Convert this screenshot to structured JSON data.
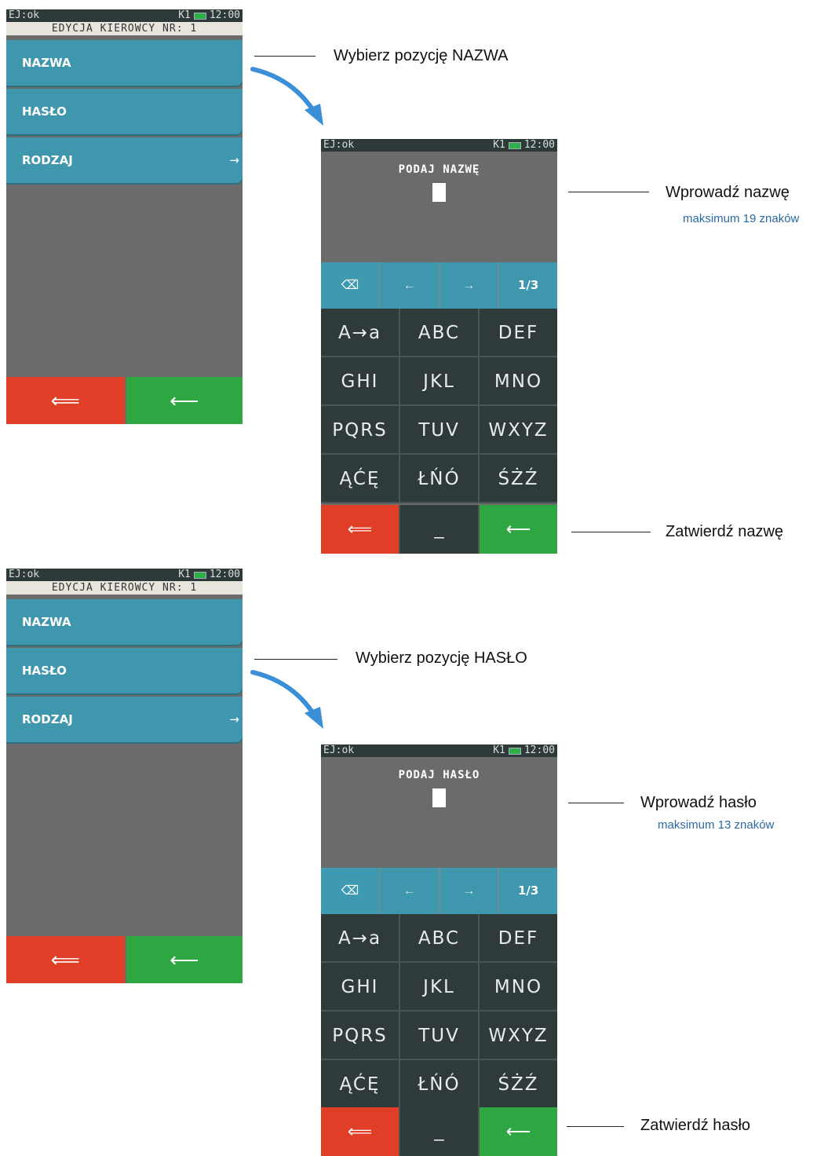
{
  "status": {
    "left": "EJ:ok",
    "right_prefix": "K1",
    "time": "12:00"
  },
  "menu_screen": {
    "title": "EDYCJA KIEROWCY NR: 1",
    "items": [
      {
        "label": "NAZWA"
      },
      {
        "label": "HASŁO"
      },
      {
        "label": "RODZAJ",
        "arrow": "→"
      }
    ],
    "back_icon": "⟸",
    "enter_icon": "⟵"
  },
  "keyboard_screens": [
    {
      "prompt": "PODAJ NAZWĘ"
    },
    {
      "prompt": "PODAJ HASŁO"
    }
  ],
  "keyboard": {
    "ctrl": [
      "⌫",
      "←",
      "→",
      "1/3"
    ],
    "rows": [
      [
        "A→a",
        "ABC",
        "DEF"
      ],
      [
        "GHI",
        "JKL",
        "MNO"
      ],
      [
        "PQRS",
        "TUV",
        "WXYZ"
      ],
      [
        "ĄĆĘ",
        "ŁŃÓ",
        "ŚŻŹ"
      ]
    ],
    "space": "_",
    "back_icon": "⟸",
    "enter_icon": "⟵"
  },
  "annotations": {
    "step1": "Wybierz pozycję NAZWA",
    "step2": "Wprowadź nazwę",
    "step2_note": "maksimum 19 znaków",
    "step3": "Zatwierdź nazwę",
    "step4": "Wybierz pozycję HASŁO",
    "step5": "Wprowadź hasło",
    "step5_note": "maksimum 13 znaków",
    "step6": "Zatwierdź hasło"
  },
  "colors": {
    "teal": "#3f97ad",
    "red": "#e03e26",
    "green": "#2ea743",
    "key": "#2e3b3a",
    "arrow": "#3b8fd6"
  }
}
